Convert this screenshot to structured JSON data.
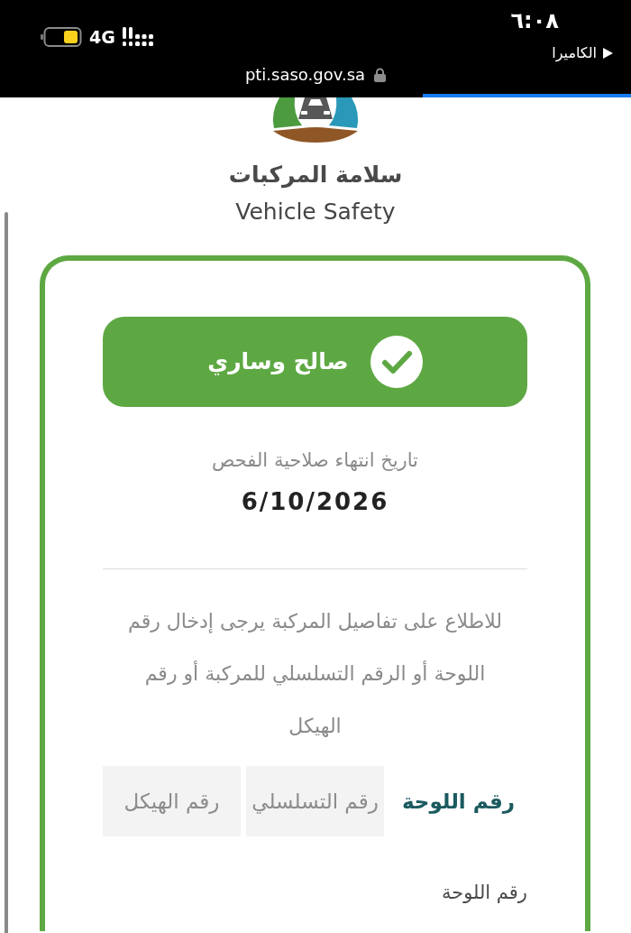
{
  "status_bar": {
    "time": "٦:٠٨",
    "back_label": "الكاميرا",
    "network": "4G",
    "url": "pti.saso.gov.sa",
    "load_progress": {
      "level": 0.33
    }
  },
  "brand": {
    "name_ar": "سلامة المركبات",
    "name_en": "Vehicle Safety"
  },
  "result": {
    "status": "صالح وساري",
    "valid": true,
    "expiry_label": "تاريخ انتهاء صلاحية الفحص",
    "expiry_date": "6/10/2026"
  },
  "instructions": "للاطلاع على تفاصيل المركبة يرجى إدخال رقم اللوحة أو الرقم التسلسلي للمركبة أو رقم الهيكل",
  "tabs": [
    {
      "label": "رقم اللوحة",
      "selected": true
    },
    {
      "label": "رقم التسلسلي",
      "selected": false
    },
    {
      "label": "رقم الهيكل",
      "selected": false
    }
  ],
  "field_label": "رقم اللوحة"
}
